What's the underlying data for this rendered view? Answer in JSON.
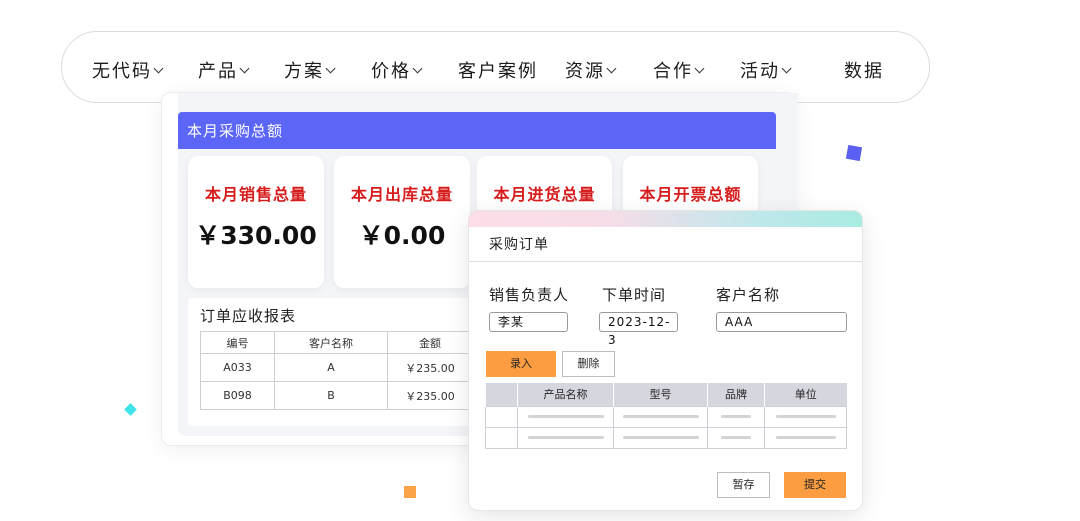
{
  "nav": {
    "items": [
      {
        "label": "无代码",
        "chevron": true
      },
      {
        "label": "产品",
        "chevron": true
      },
      {
        "label": "方案",
        "chevron": true
      },
      {
        "label": "价格",
        "chevron": true
      },
      {
        "label": "客户案例",
        "chevron": false
      },
      {
        "label": "资源",
        "chevron": true
      },
      {
        "label": "合作",
        "chevron": true
      },
      {
        "label": "活动",
        "chevron": true
      },
      {
        "label": "数据",
        "chevron": false
      }
    ]
  },
  "dashboard": {
    "header": "本月采购总额",
    "stats": [
      {
        "label": "本月销售总量",
        "value": "￥330.00"
      },
      {
        "label": "本月出库总量",
        "value": "￥0.00"
      },
      {
        "label": "本月进货总量",
        "value": ""
      },
      {
        "label": "本月开票总额",
        "value": ""
      }
    ],
    "report": {
      "title": "订单应收报表",
      "columns": [
        "编号",
        "客户名称",
        "金额"
      ],
      "rows": [
        [
          "A033",
          "A",
          "￥235.00"
        ],
        [
          "B098",
          "B",
          "￥235.00"
        ]
      ]
    }
  },
  "order": {
    "title": "采购订单",
    "fields": [
      {
        "label": "销售负责人",
        "value": "李某"
      },
      {
        "label": "下单时间",
        "value": "2023-12-3"
      },
      {
        "label": "客户名称",
        "value": "AAA"
      }
    ],
    "buttons": {
      "enter": "录入",
      "delete": "删除",
      "save": "暂存",
      "submit": "提交"
    },
    "table_columns": [
      "",
      "产品名称",
      "型号",
      "品牌",
      "单位"
    ]
  },
  "colors": {
    "accent": "#5b66f6",
    "stat_label": "#d61c1c",
    "orange_button": "#fb9d40",
    "deco_blue": "#5b5ff2",
    "deco_cyan": "#3ee3ec",
    "deco_orange": "#fba349"
  }
}
